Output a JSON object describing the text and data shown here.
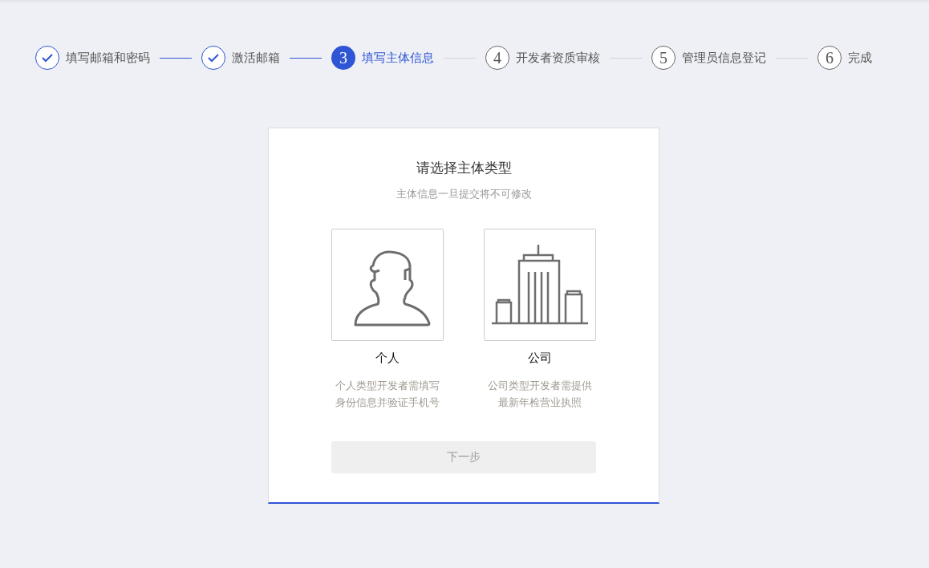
{
  "steps": [
    {
      "label": "填写邮箱和密码",
      "completed": true,
      "selected": false
    },
    {
      "label": "激活邮箱",
      "completed": true,
      "selected": false
    },
    {
      "number": "3",
      "label": "填写主体信息",
      "completed": false,
      "selected": true
    },
    {
      "number": "4",
      "label": "开发者资质审核",
      "completed": false,
      "selected": false
    },
    {
      "number": "5",
      "label": "管理员信息登记",
      "completed": false,
      "selected": false
    },
    {
      "number": "6",
      "label": "完成",
      "completed": false,
      "selected": false
    }
  ],
  "card": {
    "title": "请选择主体类型",
    "subtitle": "主体信息一旦提交将不可修改",
    "options": [
      {
        "kind": "person",
        "label": "个人",
        "selected": false,
        "description": [
          "个人类型开发者需填写",
          "身份信息并验证手机号"
        ]
      },
      {
        "kind": "company",
        "label": "公司",
        "selected": false,
        "description": [
          "公司类型开发者需提供",
          "最新年检营业执照"
        ]
      }
    ],
    "next_button": {
      "label": "下一步",
      "disabled": true
    }
  }
}
